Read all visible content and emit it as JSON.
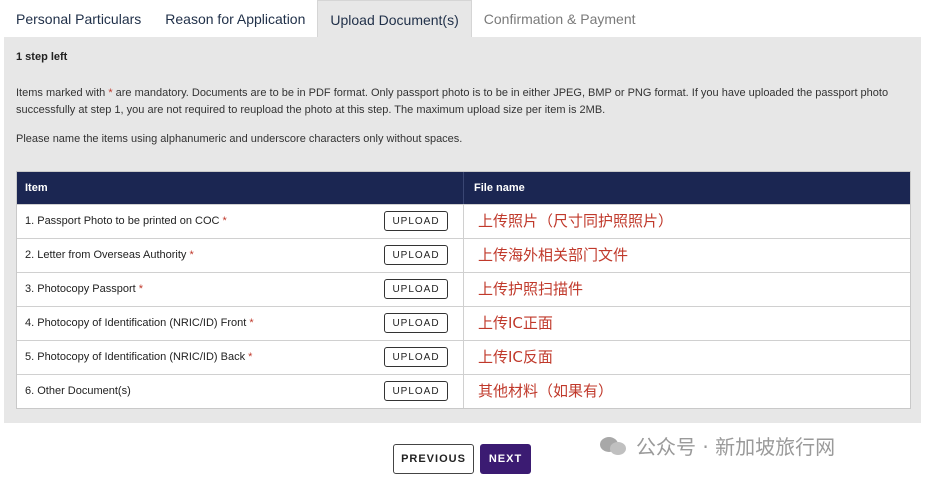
{
  "tabs": [
    {
      "label": "Personal Particulars",
      "state": "normal"
    },
    {
      "label": "Reason for Application",
      "state": "normal"
    },
    {
      "label": "Upload Document(s)",
      "state": "active"
    },
    {
      "label": "Confirmation & Payment",
      "state": "disabled"
    }
  ],
  "panel": {
    "step_text": "1 step left",
    "info_before_star": "Items marked with ",
    "info_star": "*",
    "info_after_star": " are mandatory. Documents are to be in PDF format. Only passport photo is to be in either JPEG, BMP or PNG format. If you have uploaded the passport photo successfully at step 1, you are not required to reupload the photo at this step. The maximum upload size per item is 2MB.",
    "naming_note": "Please name the items using alphanumeric and underscore characters only without spaces."
  },
  "table": {
    "headers": {
      "item": "Item",
      "file_name": "File name"
    },
    "upload_label": "UPLOAD",
    "rows": [
      {
        "item": "1. Passport Photo to be printed on COC",
        "required": "*",
        "file_note": "上传照片（尺寸同护照照片）"
      },
      {
        "item": "2. Letter from Overseas Authority",
        "required": "*",
        "file_note": "上传海外相关部门文件"
      },
      {
        "item": "3. Photocopy Passport",
        "required": "*",
        "file_note": "上传护照扫描件"
      },
      {
        "item": "4. Photocopy of Identification (NRIC/ID) Front",
        "required": "*",
        "file_note": "上传IC正面"
      },
      {
        "item": "5. Photocopy of Identification (NRIC/ID) Back",
        "required": "*",
        "file_note": "上传IC反面"
      },
      {
        "item": "6. Other Document(s)",
        "required": "",
        "file_note": "其他材料（如果有）"
      }
    ]
  },
  "buttons": {
    "previous": "PREVIOUS",
    "next": "NEXT"
  },
  "watermark": {
    "text": "公众号 · 新加坡旅行网",
    "icon": "wechat-icon"
  },
  "colors": {
    "header_bg": "#1b2652",
    "next_bg": "#3b1b72",
    "annotation": "#c0392b",
    "panel_bg": "#e7e7e7"
  }
}
